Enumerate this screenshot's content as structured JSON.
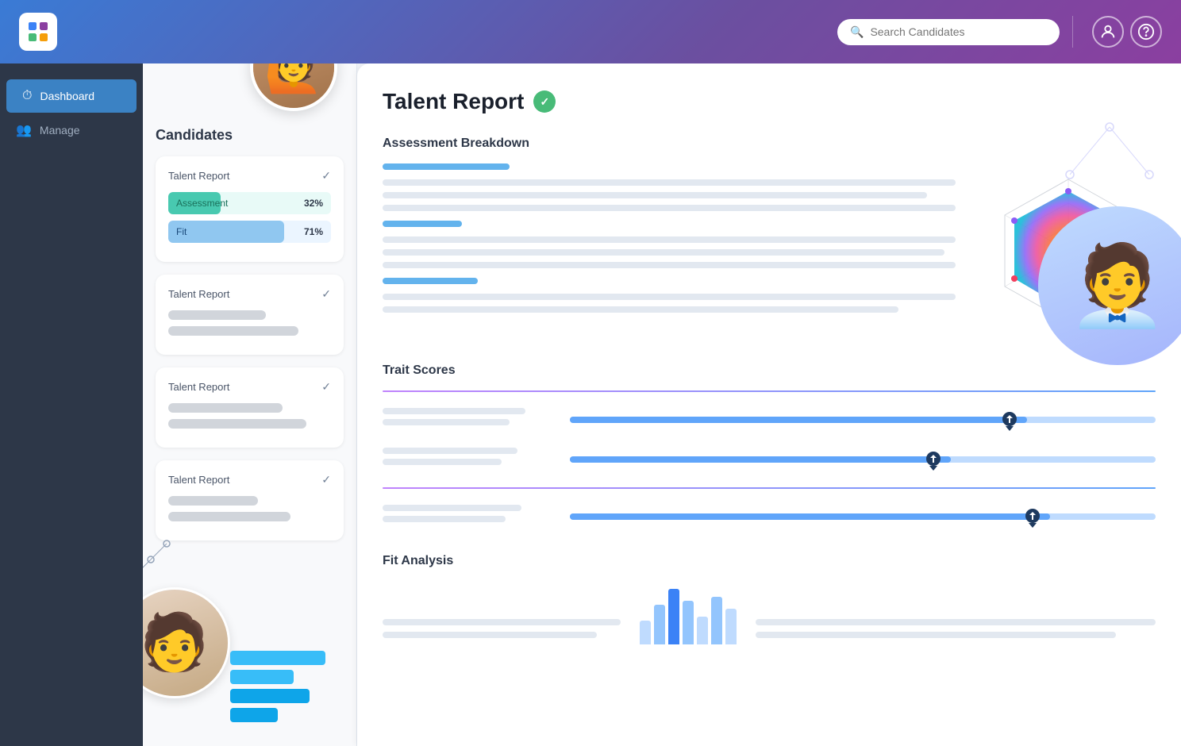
{
  "header": {
    "logo_alt": "Mettl logo",
    "search_placeholder": "Search Candidates",
    "nav_items": [
      "user-icon",
      "help-icon"
    ]
  },
  "sidebar": {
    "items": [
      {
        "id": "dashboard",
        "label": "Dashboard",
        "icon": "⏱",
        "active": true
      },
      {
        "id": "manage",
        "label": "Manage",
        "icon": "👥",
        "active": false
      }
    ]
  },
  "candidates": {
    "title": "Candidates",
    "cards": [
      {
        "id": "card-1",
        "title": "Talent Report",
        "verified": true,
        "bars": [
          {
            "label": "Assessment",
            "value": "32%",
            "pct": 32,
            "color": "assessment"
          },
          {
            "label": "Fit",
            "value": "71%",
            "pct": 71,
            "color": "fit"
          }
        ]
      },
      {
        "id": "card-2",
        "title": "Talent Report",
        "verified": true,
        "placeholder": true
      },
      {
        "id": "card-3",
        "title": "Talent Report",
        "verified": true,
        "placeholder": true
      },
      {
        "id": "card-4",
        "title": "Talent Report",
        "verified": true,
        "placeholder": true
      }
    ]
  },
  "report": {
    "title": "Talent Report",
    "verified": true,
    "sections": [
      {
        "id": "assessment-breakdown",
        "title": "Assessment Breakdown"
      },
      {
        "id": "trait-scores",
        "title": "Trait Scores"
      },
      {
        "id": "fit-analysis",
        "title": "Fit Analysis"
      }
    ],
    "traits": [
      {
        "pct": 78,
        "marker": 78
      },
      {
        "pct": 65,
        "marker": 65
      },
      {
        "pct": 82,
        "marker": 82
      }
    ]
  },
  "colors": {
    "sidebar_bg": "#2d3748",
    "sidebar_active": "#3b82c4",
    "header_start": "#3a7bd5",
    "header_end": "#8b3fa0",
    "accent_blue": "#60a5fa",
    "accent_green": "#48bb78"
  }
}
